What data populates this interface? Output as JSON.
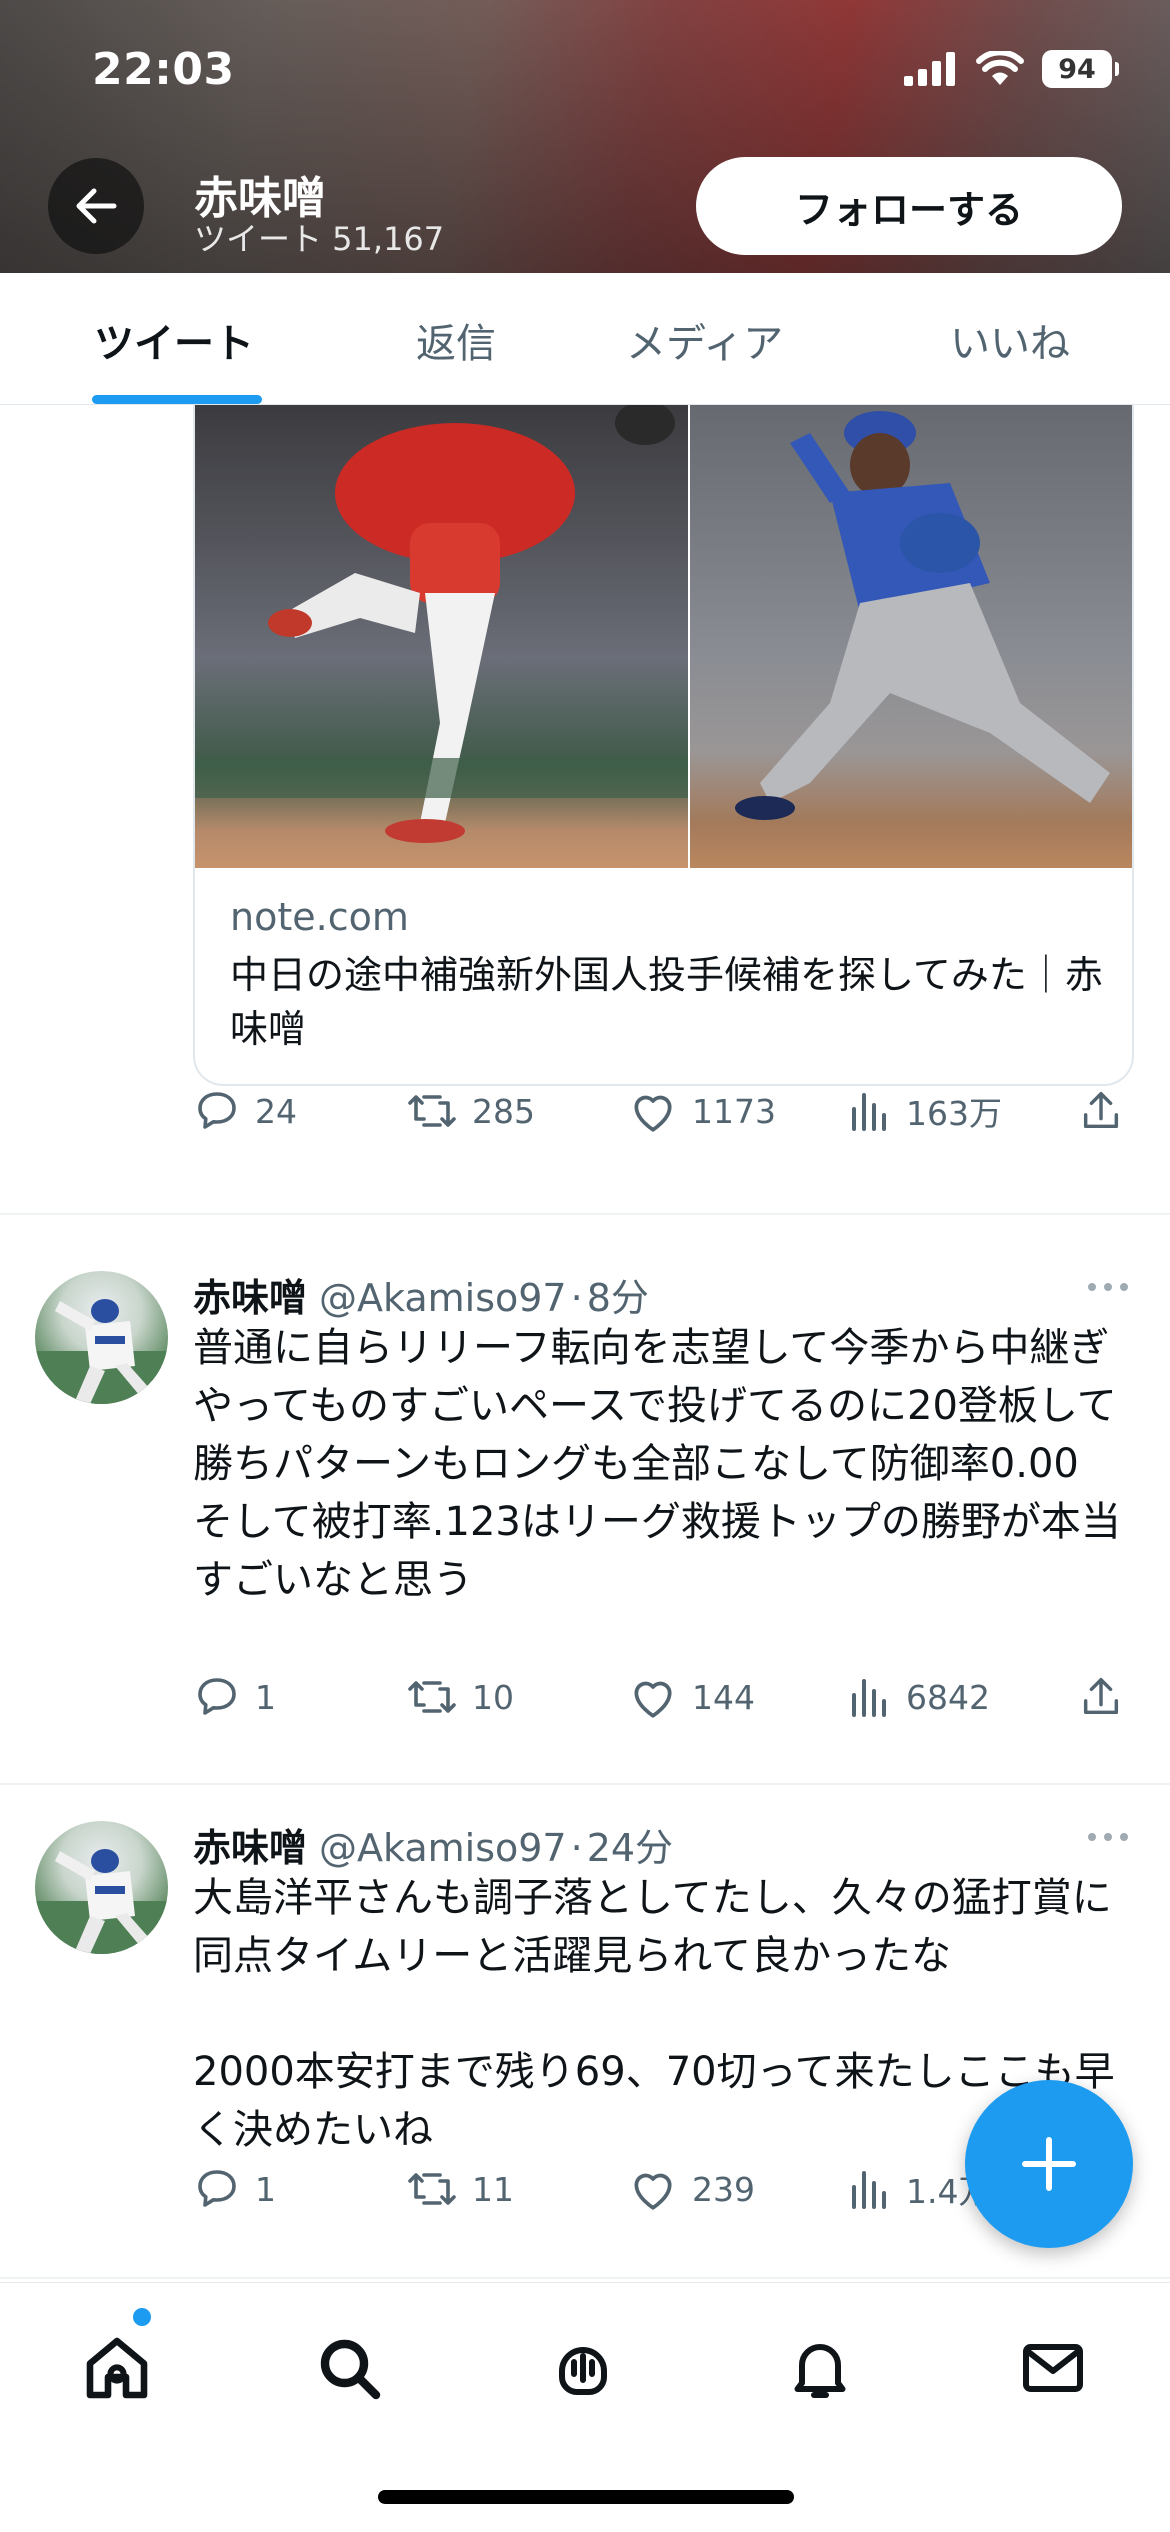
{
  "status_bar": {
    "time": "22:03",
    "battery": "94"
  },
  "header": {
    "name": "赤味噌",
    "tweet_count": "ツイート 51,167",
    "follow_label": "フォローする"
  },
  "tabs": [
    "ツイート",
    "返信",
    "メディア",
    "いいね"
  ],
  "link_card": {
    "domain": "note.com",
    "title": "中日の途中補強新外国人投手候補を探してみた｜赤味噌",
    "actions": {
      "replies": "24",
      "retweets": "285",
      "likes": "1173",
      "views": "163万"
    }
  },
  "tweets": [
    {
      "name": "赤味噌",
      "handle": "@Akamiso97",
      "time": "8分",
      "text": "普通に自らリリーフ転向を志望して今季から中継ぎやってものすごいペースで投げてるのに20登板して勝ちパターンもロングも全部こなして防御率0.00\nそして被打率.123はリーグ救援トップの勝野が本当すごいなと思う",
      "actions": {
        "replies": "1",
        "retweets": "10",
        "likes": "144",
        "views": "6842"
      }
    },
    {
      "name": "赤味噌",
      "handle": "@Akamiso97",
      "time": "24分",
      "text": "大島洋平さんも調子落としてたし、久々の猛打賞に同点タイムリーと活躍見られて良かったな\n\n2000本安打まで残り69、70切って来たしここも早く決めたいね",
      "actions": {
        "replies": "1",
        "retweets": "11",
        "likes": "239",
        "views": "1.4万"
      }
    }
  ],
  "nav": [
    "home-icon",
    "search-icon",
    "spaces-icon",
    "notifications-icon",
    "messages-icon"
  ],
  "colors": {
    "accent": "#1d9bf0",
    "text": "#0f1419",
    "secondary": "#536471"
  }
}
